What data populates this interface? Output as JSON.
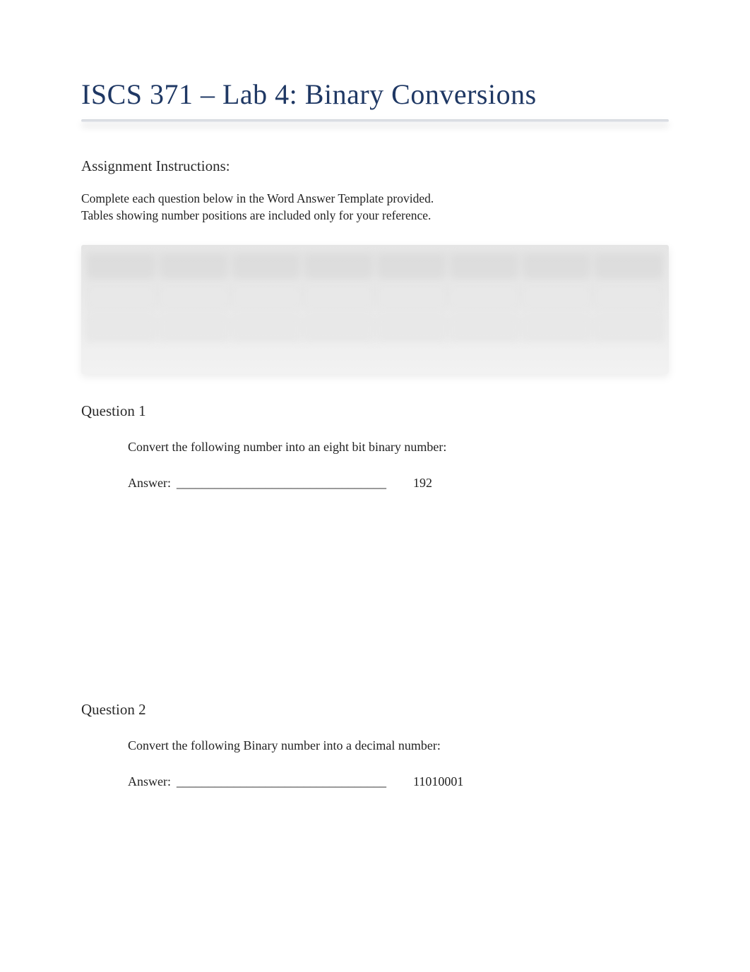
{
  "title": "ISCS 371 – Lab 4: Binary Conversions",
  "instructions": {
    "heading": "Assignment Instructions:",
    "line1": "Complete each question below in the Word Answer Template provided.",
    "line2": "Tables showing number positions are included only for your reference."
  },
  "questions": [
    {
      "heading": "Question 1",
      "prompt": "Convert the following number into an eight bit binary number:",
      "answer_label": "Answer:",
      "blank": "_________________________________",
      "value": "192"
    },
    {
      "heading": "Question 2",
      "prompt": "Convert the following Binary number into a decimal number:",
      "answer_label": "Answer:",
      "blank": "_________________________________",
      "value": "11010001"
    }
  ]
}
